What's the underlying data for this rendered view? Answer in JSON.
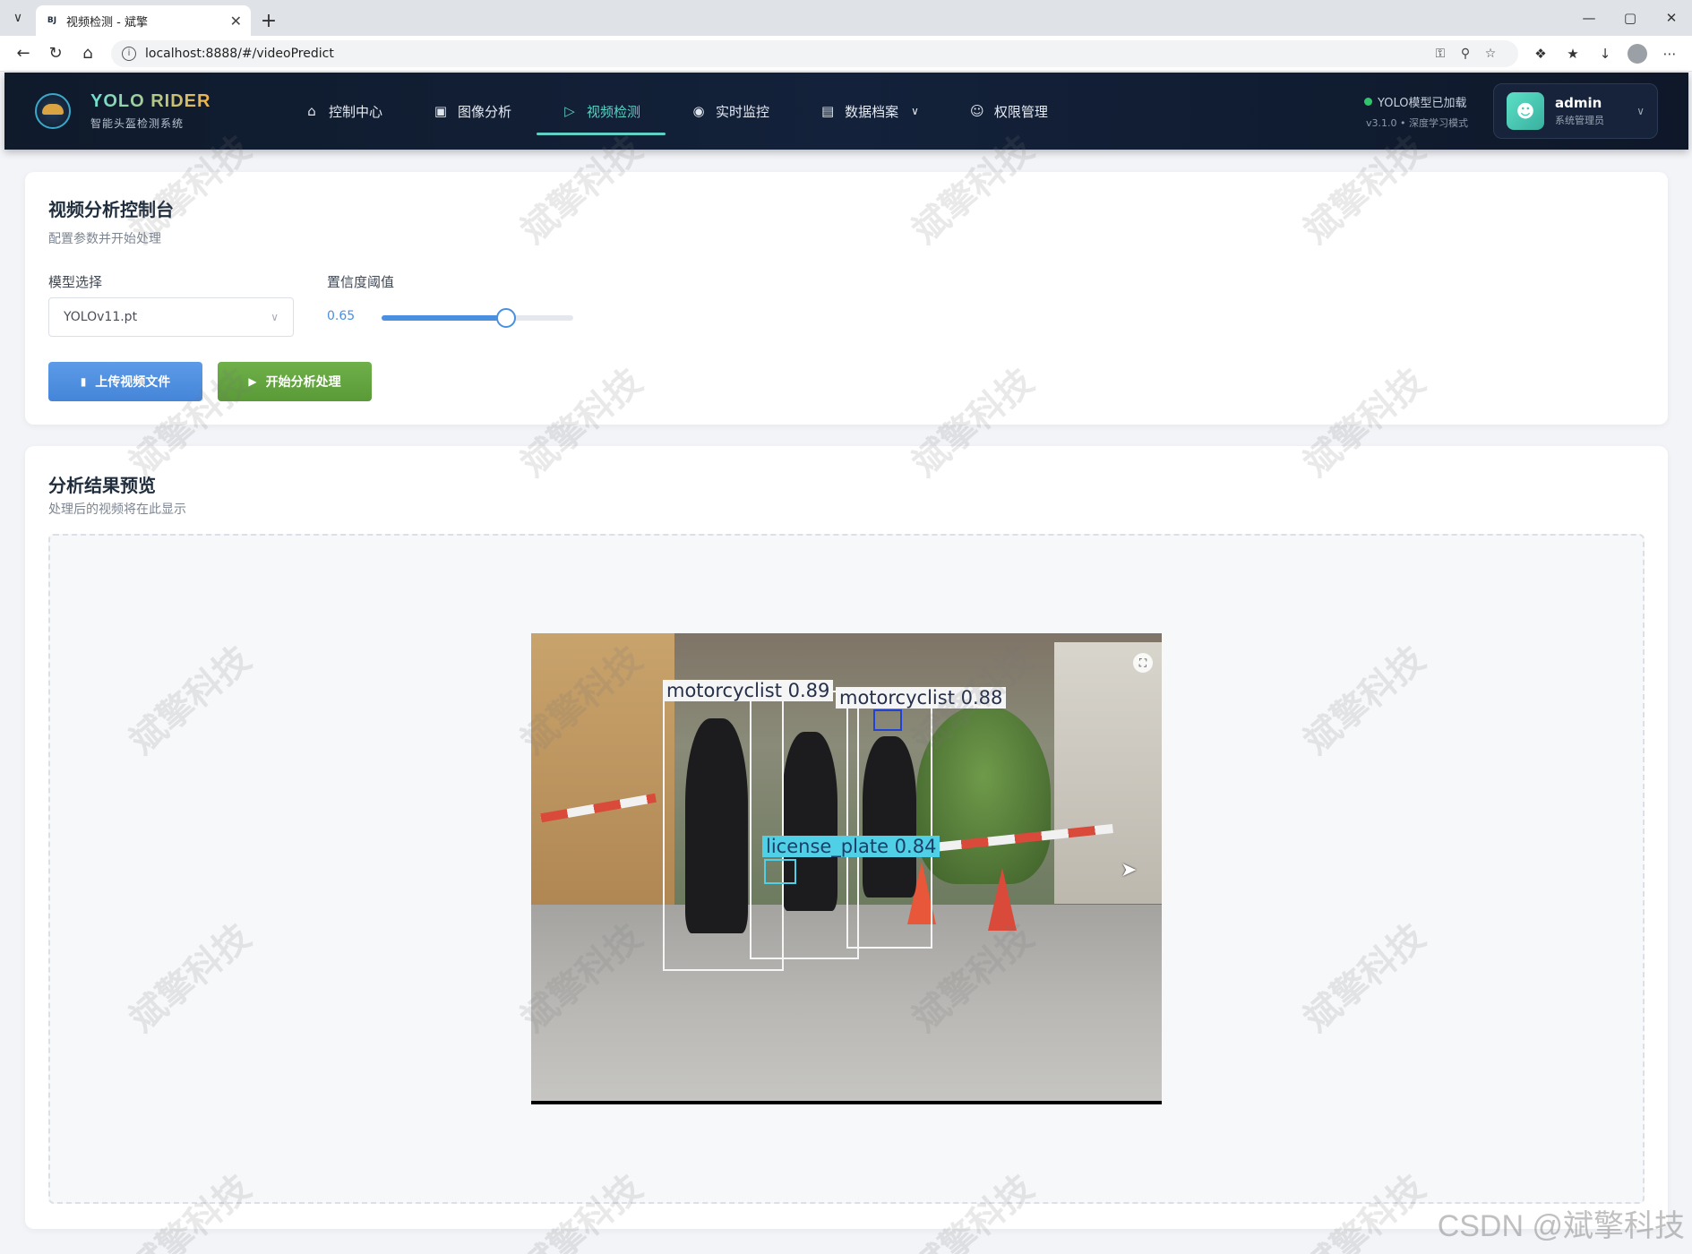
{
  "browser": {
    "tab_title": "视频检测 - 斌擎",
    "favicon_text": "BJ",
    "url": "localhost:8888/#/videoPredict"
  },
  "header": {
    "logo_title": "YOLO RIDER",
    "logo_subtitle": "智能头盔检测系统",
    "nav": [
      {
        "label": "控制中心",
        "icon": "home-icon"
      },
      {
        "label": "图像分析",
        "icon": "image-icon"
      },
      {
        "label": "视频检测",
        "icon": "play-circle-icon"
      },
      {
        "label": "实时监控",
        "icon": "camera-icon"
      },
      {
        "label": "数据档案",
        "icon": "document-icon"
      },
      {
        "label": "权限管理",
        "icon": "user-icon"
      }
    ],
    "active_nav": "视频检测",
    "status_text": "YOLO模型已加载",
    "status_version": "v3.1.0 • 深度学习模式",
    "user_name": "admin",
    "user_role": "系统管理员"
  },
  "control": {
    "title": "视频分析控制台",
    "subtitle": "配置参数并开始处理",
    "model_label": "模型选择",
    "model_value": "YOLOv11.pt",
    "confidence_label": "置信度阈值",
    "confidence_value": "0.65",
    "confidence_fraction": 0.65,
    "upload_label": "上传视频文件",
    "start_label": "开始分析处理"
  },
  "result": {
    "title": "分析结果预览",
    "subtitle": "处理后的视频将在此显示",
    "detections": [
      {
        "label": "motorcyclist 0.89",
        "color": "white"
      },
      {
        "label": "motorcyclist 0.88",
        "color": "white"
      },
      {
        "label": "license_plate 0.84",
        "color": "cyan"
      }
    ]
  },
  "watermark_text": "斌擎科技",
  "csdn_watermark": "CSDN @斌擎科技",
  "colors": {
    "accent": "#5fd0c4",
    "primary": "#4a8fe0",
    "success": "#5a9a37",
    "header_bg": "#13213a"
  }
}
